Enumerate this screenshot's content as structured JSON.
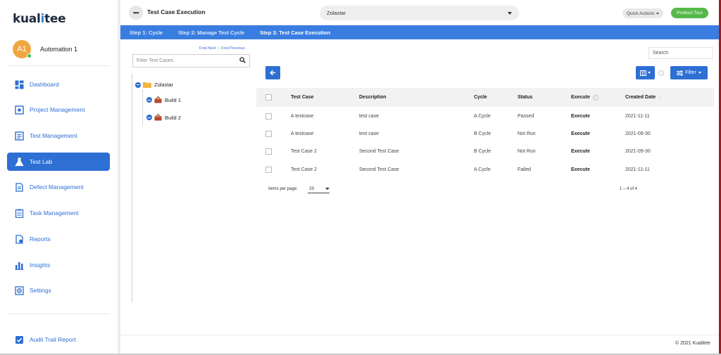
{
  "brand": {
    "logo_text_pre": "kual",
    "logo_text_pin": "i",
    "logo_text_post": "tee"
  },
  "user": {
    "initials": "A1",
    "name": "Automation 1"
  },
  "nav": {
    "items": [
      {
        "label": "Dashboard",
        "icon": "dashboard-icon"
      },
      {
        "label": "Project Management",
        "icon": "project-icon"
      },
      {
        "label": "Test Management",
        "icon": "test-management-icon"
      },
      {
        "label": "Test Lab",
        "icon": "flask-icon",
        "active": true
      },
      {
        "label": "Defect Management",
        "icon": "defect-icon"
      },
      {
        "label": "Task Management",
        "icon": "task-icon"
      },
      {
        "label": "Reports",
        "icon": "reports-icon"
      },
      {
        "label": "Insights",
        "icon": "insights-icon"
      },
      {
        "label": "Settings",
        "icon": "settings-icon"
      }
    ],
    "audit": {
      "label": "Audit Trail Report",
      "icon": "checkbox-icon"
    }
  },
  "header": {
    "menu_icon": "more-dots-icon",
    "title": "Test Case Execution",
    "project": "Zolastar",
    "quick_actions": "Quick Actions",
    "product_tour": "Product Tour"
  },
  "steps": [
    {
      "label": "Step 1: Cycle"
    },
    {
      "label": "Step 2: Manage Test Cycle"
    },
    {
      "label": "Step 3: Test Case Execution",
      "active": true
    }
  ],
  "tree": {
    "find_next": "Find Next",
    "find_previous": "Find Previous",
    "filter_placeholder": "Filter Test Cases",
    "root": "Zolastar",
    "children": [
      "Build 1",
      "Build 2"
    ]
  },
  "table": {
    "search_placeholder": "Search",
    "filter_label": "Filter",
    "columns": [
      "Test Case",
      "Description",
      "Cycle",
      "Status",
      "Execute",
      "Created Date"
    ],
    "rows": [
      {
        "test_case": "A testcase",
        "description": "test case",
        "cycle": "A Cycle",
        "status": "Passed",
        "execute": "Execute",
        "created": "2021-11-11"
      },
      {
        "test_case": "A testcase",
        "description": "test case",
        "cycle": "B Cycle",
        "status": "Not Run",
        "execute": "Execute",
        "created": "2021-09-30"
      },
      {
        "test_case": "Test Case 2",
        "description": "Second Test Case",
        "cycle": "B Cycle",
        "status": "Not Run",
        "execute": "Execute",
        "created": "2021-09-30"
      },
      {
        "test_case": "Test Case 2",
        "description": "Second Test Case",
        "cycle": "A Cycle",
        "status": "Failed",
        "execute": "Execute",
        "created": "2021-11-11"
      }
    ],
    "items_per_page_label": "Items per page:",
    "items_per_page": "20",
    "range": "1 – 4 of 4"
  },
  "footer": {
    "copyright": "© 2021 Kualitee"
  },
  "colors": {
    "primary": "#2d6fd3",
    "steps_bar": "#3a7de0",
    "tour_green": "#56b84a",
    "avatar": "#f0a640"
  }
}
